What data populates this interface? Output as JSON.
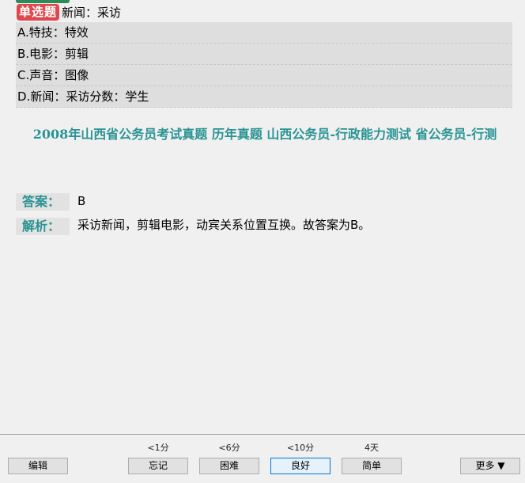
{
  "question": {
    "type_badge": "单选题",
    "stem": "新闻：采访",
    "options": [
      {
        "text": "A.特技：特效"
      },
      {
        "text": "B.电影：剪辑"
      },
      {
        "text": "C.声音：图像"
      },
      {
        "text": "D.新闻：采访分数：学生"
      }
    ]
  },
  "source": "2008年山西省公务员考试真题 历年真题 山西公务员-行政能力测试 省公务员-行测",
  "answer": {
    "label": "答案：",
    "value": "B"
  },
  "analysis": {
    "label": "解析：",
    "value": "采访新闻，剪辑电影，动宾关系位置互换。故答案为B。"
  },
  "bottombar": {
    "edit_label": "编辑",
    "more_label": "更多 ▼",
    "ratings": [
      {
        "interval": "<1分",
        "label": "忘记"
      },
      {
        "interval": "<6分",
        "label": "困难"
      },
      {
        "interval": "<10分",
        "label": "良好"
      },
      {
        "interval": "4天",
        "label": "简单"
      }
    ]
  }
}
